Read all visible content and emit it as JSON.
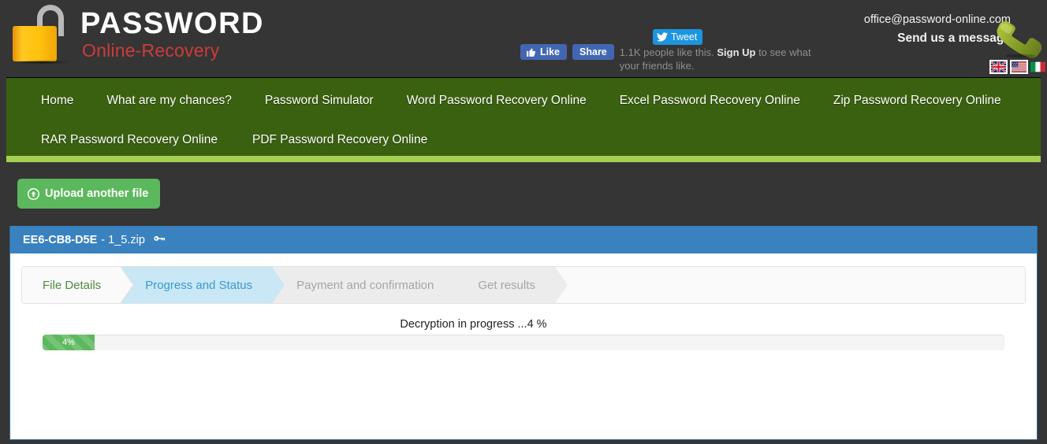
{
  "brand": {
    "title": "PASSWORD",
    "subtitle": "Online-Recovery",
    "logo_icon": "open-padlock-icon"
  },
  "social": {
    "tweet_label": "Tweet",
    "tweet_icon": "twitter-bird-icon",
    "like_label": "Like",
    "like_icon": "thumbs-up-icon",
    "share_label": "Share",
    "facebook_text_prefix": "1.1K people like this. ",
    "facebook_signup": "Sign Up",
    "facebook_text_suffix": " to see what your friends like.",
    "facebook_blue": "#4267b2",
    "twitter_blue": "#1b95e0"
  },
  "contact": {
    "email": "office@password-online.com",
    "message_label": "Send us a message",
    "phone_icon": "telephone-handset-icon",
    "languages": [
      {
        "name": "english-uk-flag-icon",
        "label": "UK"
      },
      {
        "name": "english-us-flag-icon",
        "label": "US"
      },
      {
        "name": "italian-flag-icon",
        "label": "IT"
      }
    ]
  },
  "nav": {
    "background": "#3a6110",
    "accent": "#a5cf53",
    "row1": [
      {
        "label": "Home"
      },
      {
        "label": "What are my chances?"
      },
      {
        "label": "Password Simulator"
      },
      {
        "label": "Word Password Recovery Online"
      },
      {
        "label": "Excel Password Recovery Online"
      },
      {
        "label": "Zip Password Recovery Online"
      }
    ],
    "row2": [
      {
        "label": "RAR Password Recovery Online"
      },
      {
        "label": "PDF Password Recovery Online"
      }
    ]
  },
  "toolbar": {
    "upload_label": "Upload another file",
    "upload_icon": "upload-circle-arrow-icon",
    "upload_color": "#5cb85c"
  },
  "panel": {
    "file_id": "EE6-CB8-D5E",
    "file_name": "- 1_5.zip",
    "key_icon": "key-icon",
    "header_color": "#3a82bf"
  },
  "wizard": {
    "steps": [
      {
        "label": "File Details",
        "state": "done"
      },
      {
        "label": "Progress and Status",
        "state": "active"
      },
      {
        "label": "Payment and confirmation",
        "state": "pending"
      },
      {
        "label": "Get results",
        "state": "pending"
      }
    ],
    "done_color": "#4f8a3d",
    "active_color": "#3a9ad0",
    "pending_color": "#a6a6a6"
  },
  "progress": {
    "status_text": "Decryption in progress ...4 %",
    "percent_label": "4%",
    "percent_value": 4,
    "bar_color": "#5cb85c"
  }
}
